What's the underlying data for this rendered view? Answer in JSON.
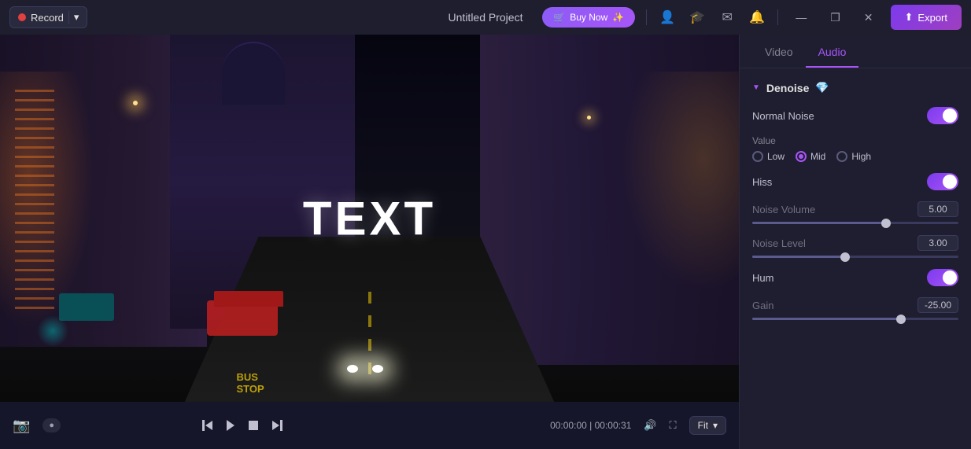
{
  "titleBar": {
    "title": "Untitled Project",
    "record": "Record",
    "export": "Export",
    "buyNow": "Buy Now"
  },
  "rightPanel": {
    "tabs": [
      {
        "id": "video",
        "label": "Video",
        "active": false
      },
      {
        "id": "audio",
        "label": "Audio",
        "active": true
      }
    ],
    "denoise": {
      "title": "Denoise",
      "normalNoise": {
        "label": "Normal Noise",
        "enabled": true
      },
      "value": {
        "label": "Value",
        "options": [
          {
            "id": "low",
            "label": "Low",
            "selected": false
          },
          {
            "id": "mid",
            "label": "Mid",
            "selected": true
          },
          {
            "id": "high",
            "label": "High",
            "selected": false
          }
        ]
      },
      "hiss": {
        "label": "Hiss",
        "enabled": true
      },
      "noiseVolume": {
        "label": "Noise Volume",
        "value": "5.00",
        "fillPct": 65,
        "thumbPct": 65
      },
      "noiseLevel": {
        "label": "Noise Level",
        "value": "3.00",
        "fillPct": 45,
        "thumbPct": 45
      },
      "hum": {
        "label": "Hum",
        "enabled": true
      },
      "gain": {
        "label": "Gain",
        "value": "-25.00",
        "fillPct": 72,
        "thumbPct": 72
      }
    }
  },
  "videoPlayer": {
    "textOverlay": "TEXT",
    "currentTime": "00:00:00",
    "totalTime": "00:00:31",
    "timeSeparator": "|",
    "fitLabel": "Fit"
  },
  "icons": {
    "cart": "🛒",
    "user": "👤",
    "hat": "🎓",
    "mail": "✉",
    "bell": "🔔",
    "minimize": "—",
    "maximize": "❐",
    "close": "✕",
    "exportIcon": "⬆",
    "screenshot": "📷",
    "volume": "🔊",
    "fullscreen": "⛶",
    "chevronDown": "▾",
    "diamond": "💎",
    "arrow": "▼"
  }
}
